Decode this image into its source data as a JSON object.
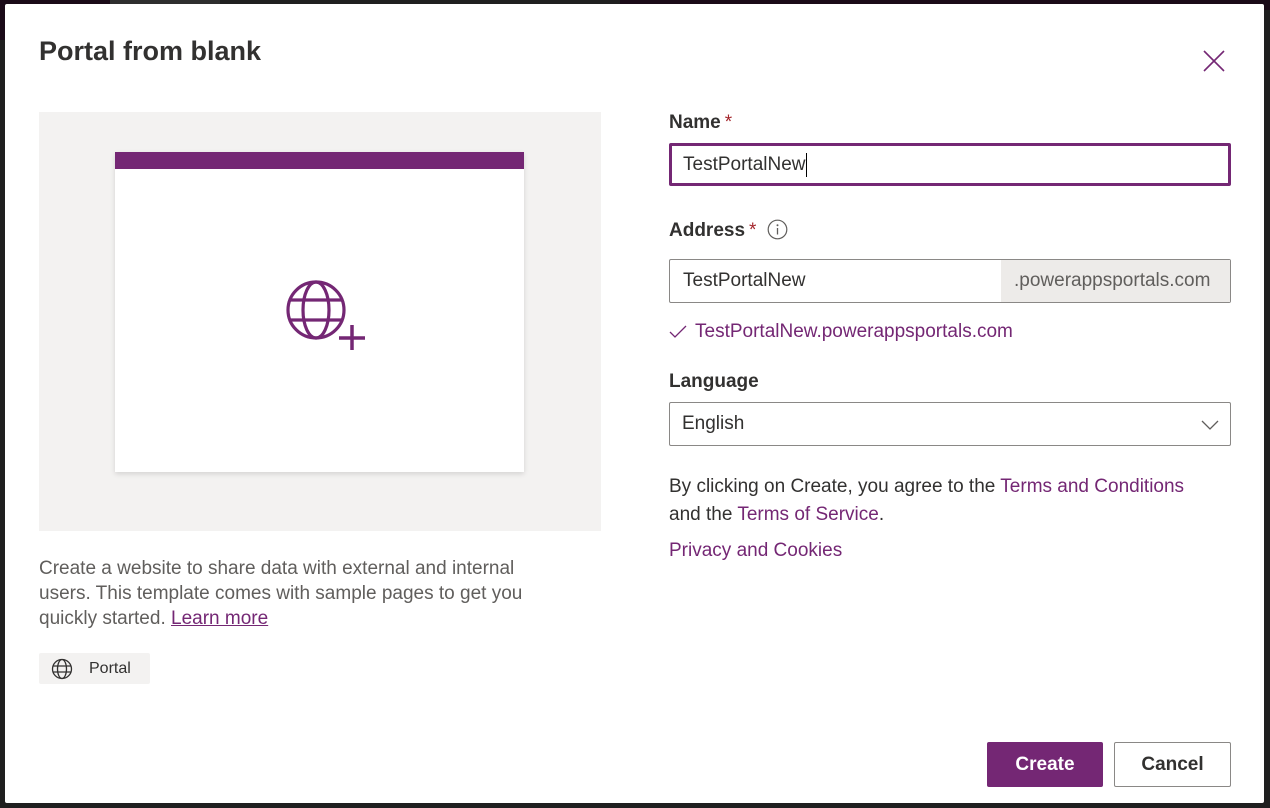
{
  "dialog": {
    "title": "Portal from blank",
    "close_icon": "close-icon"
  },
  "preview": {
    "icon": "globe-add-icon",
    "accent_color": "#742774"
  },
  "description": {
    "text": "Create a website to share data with external and internal users. This template comes with sample pages to get you quickly started.",
    "learn_more": "Learn more"
  },
  "tag": {
    "icon": "globe-icon",
    "label": "Portal"
  },
  "form": {
    "name": {
      "label": "Name",
      "required_marker": "*",
      "value": "TestPortalNew"
    },
    "address": {
      "label": "Address",
      "required_marker": "*",
      "info_icon": "info-icon",
      "value": "TestPortalNew",
      "suffix": ".powerappsportals.com",
      "validation_icon": "checkmark-icon",
      "validation_text": "TestPortalNew.powerappsportals.com"
    },
    "language": {
      "label": "Language",
      "selected": "English",
      "icon": "chevron-down-icon"
    }
  },
  "legal": {
    "prefix": "By clicking on Create, you agree to the ",
    "terms_conditions": "Terms and Conditions",
    "middle": " and the ",
    "terms_service": "Terms of Service",
    "suffix": ".",
    "privacy": "Privacy and Cookies"
  },
  "buttons": {
    "create": "Create",
    "cancel": "Cancel"
  },
  "colors": {
    "brand": "#742774",
    "required": "#a4262c",
    "text": "#323130",
    "secondary_text": "#605e5c"
  }
}
